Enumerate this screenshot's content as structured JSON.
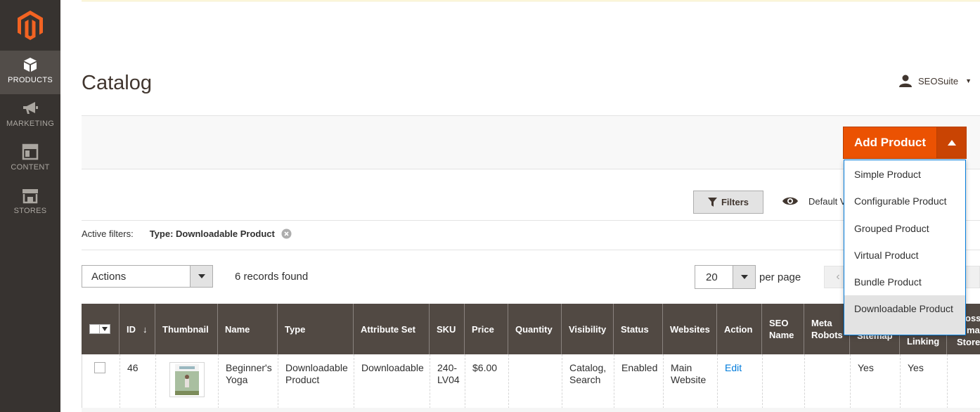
{
  "sidebar": {
    "items": [
      {
        "label": "PRODUCTS",
        "icon": "box-icon",
        "active": true
      },
      {
        "label": "MARKETING",
        "icon": "megaphone-icon",
        "active": false
      },
      {
        "label": "CONTENT",
        "icon": "layout-icon",
        "active": false
      },
      {
        "label": "STORES",
        "icon": "store-icon",
        "active": false
      }
    ]
  },
  "header": {
    "title": "Catalog",
    "user": "SEOSuite"
  },
  "add_product": {
    "label": "Add Product",
    "menu": [
      "Simple Product",
      "Configurable Product",
      "Grouped Product",
      "Virtual Product",
      "Bundle Product",
      "Downloadable Product"
    ],
    "highlighted": "Downloadable Product"
  },
  "toolbar": {
    "filters_label": "Filters",
    "view_label": "Default V",
    "active_filters_label": "Active filters:",
    "active_filter_value": "Type: Downloadable Product",
    "actions_value": "Actions",
    "records_found": "6 records found",
    "per_page_value": "20",
    "per_page_label": "per page"
  },
  "grid": {
    "columns": [
      "ID",
      "Thumbnail",
      "Name",
      "Type",
      "Attribute Set",
      "SKU",
      "Price",
      "Quantity",
      "Visibility",
      "Status",
      "Websites",
      "Action",
      "SEO Name",
      "Meta Robots",
      "Sitemap",
      "Linking",
      "Store"
    ],
    "col_partial_top": [
      "",
      "",
      "oss",
      "ma"
    ],
    "rows": [
      {
        "id": "46",
        "name": "Beginner's Yoga",
        "type": "Downloadable Product",
        "attribute_set": "Downloadable",
        "sku": "240-LV04",
        "price": "$6.00",
        "quantity": "",
        "visibility": "Catalog, Search",
        "status": "Enabled",
        "websites": "Main Website",
        "action": "Edit",
        "seo_name": "",
        "meta_robots": "",
        "sitemap": "Yes",
        "linking": "Yes"
      }
    ]
  },
  "colors": {
    "sidebar_bg": "#373330",
    "accent": "#eb5202",
    "grid_header": "#514943",
    "link": "#007bdb"
  }
}
